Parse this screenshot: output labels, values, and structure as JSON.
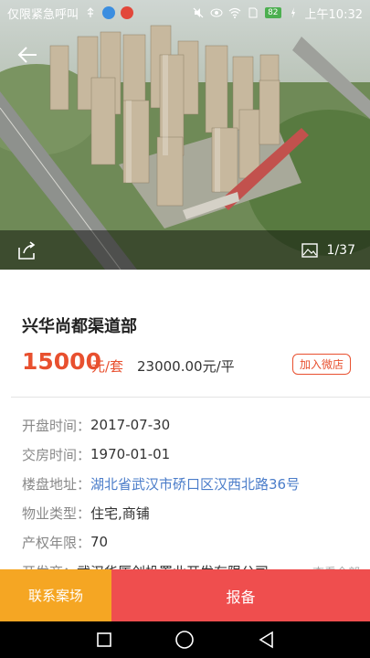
{
  "status_bar": {
    "carrier_text": "仅限紧急呼叫",
    "battery": "82",
    "time": "上午10:32"
  },
  "gallery": {
    "current": "1",
    "total": "37",
    "counter": "1/37"
  },
  "property": {
    "title": "兴华尚都渠道部",
    "price": "15000",
    "price_unit": "元/套",
    "unit_price": "23000.00元/平",
    "wechat_button": "加入微店"
  },
  "info": [
    {
      "label": "开盘时间：",
      "value": "2017-07-30"
    },
    {
      "label": "交房时间：",
      "value": "1970-01-01"
    },
    {
      "label": "楼盘地址：",
      "value": "湖北省武汉市硚口区汉西北路36号"
    },
    {
      "label": "物业类型：",
      "value": "住宅,商铺"
    },
    {
      "label": "产权年限：",
      "value": "70"
    },
    {
      "label": "开发商：",
      "value": "武汉华厦创投置业开发有限公司",
      "more": "查看全部"
    }
  ],
  "actions": {
    "contact": "联系案场",
    "report": "报备"
  },
  "colors": {
    "accent_red": "#e8502f",
    "contact_orange": "#f5a623",
    "report_red": "#ef4e4e",
    "link_blue": "#4a7cc9"
  },
  "icons": [
    "back-arrow-icon",
    "share-icon",
    "album-icon",
    "nav-back-icon",
    "nav-home-icon",
    "nav-recents-icon"
  ]
}
